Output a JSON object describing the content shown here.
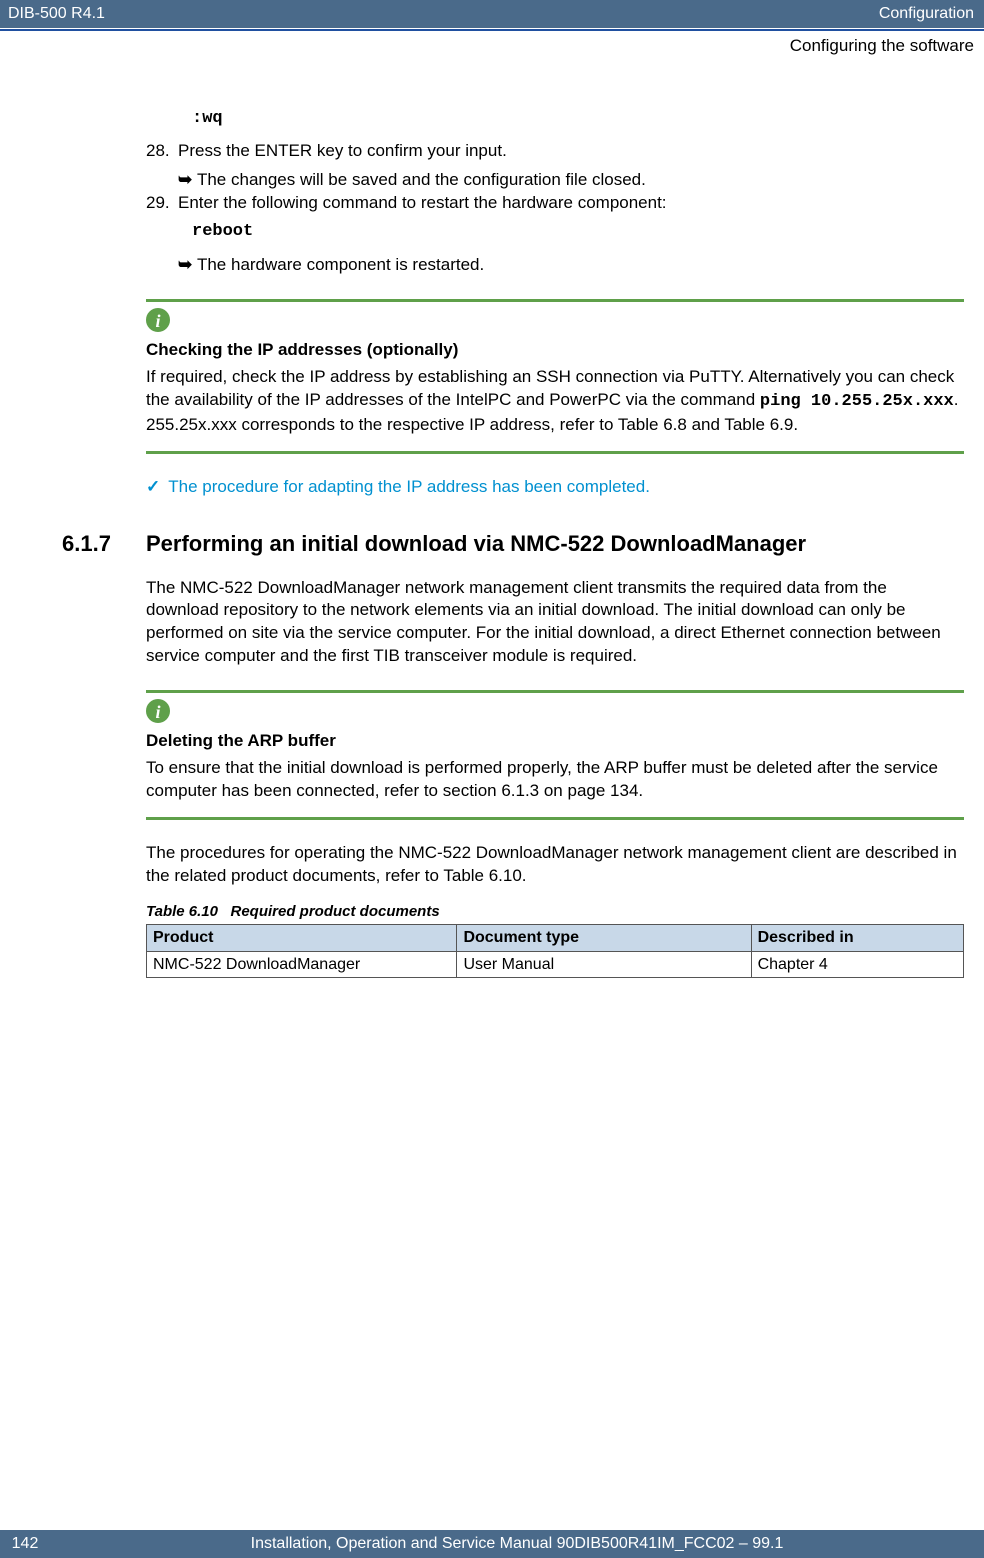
{
  "header": {
    "left": "DIB-500 R4.1",
    "right": "Configuration",
    "sub": "Configuring the software"
  },
  "code_wq": ":wq",
  "step28_num": "28.",
  "step28_text": "Press the ENTER key to confirm your input.",
  "step28_result": "The changes will be saved and the configuration file closed.",
  "step29_num": "29.",
  "step29_text": "Enter the following command to restart the hardware component:",
  "code_reboot": "reboot",
  "step29_result": "The hardware component is restarted.",
  "info1_title": "Checking the IP addresses (optionally)",
  "info1_pre": "If required, check the IP address by establishing an SSH connection via PuTTY. Alternatively you can check the availability of the IP addresses of the IntelPC and PowerPC via the command ",
  "info1_code": "ping 10.255.25x.xxx",
  "info1_post": ". 255.25x.xxx corresponds to the respective IP address, refer to Table 6.8 and Table 6.9.",
  "check_text": "The procedure for adapting the IP address has been completed.",
  "section_num": "6.1.7",
  "section_title": "Performing an initial download via NMC-522 DownloadManager",
  "para_intro": "The NMC-522 DownloadManager network management client transmits the required data from the download repository to the network elements via an initial download. The initial download can only be performed on site via the service computer. For the initial download, a direct Ethernet connection between service computer and the first TIB transceiver module is required.",
  "info2_title": "Deleting the ARP buffer",
  "info2_text": "To ensure that the initial download is performed properly, the ARP buffer must be deleted after the service computer has been connected, refer to section 6.1.3 on page 134.",
  "para_procedures": "The procedures for operating the NMC-522 DownloadManager network management client are described in the related product documents, refer to Table 6.10.",
  "table_caption_pre": "Table 6.10",
  "table_caption_text": "Required product documents",
  "table": {
    "h1": "Product",
    "h2": "Document type",
    "h3": "Described in",
    "r1c1": "NMC-522 DownloadManager",
    "r1c2": "User Manual",
    "r1c3": "Chapter 4"
  },
  "footer": {
    "page": "142",
    "text": "Installation, Operation and Service Manual 90DIB500R41IM_FCC02 – 99.1"
  }
}
